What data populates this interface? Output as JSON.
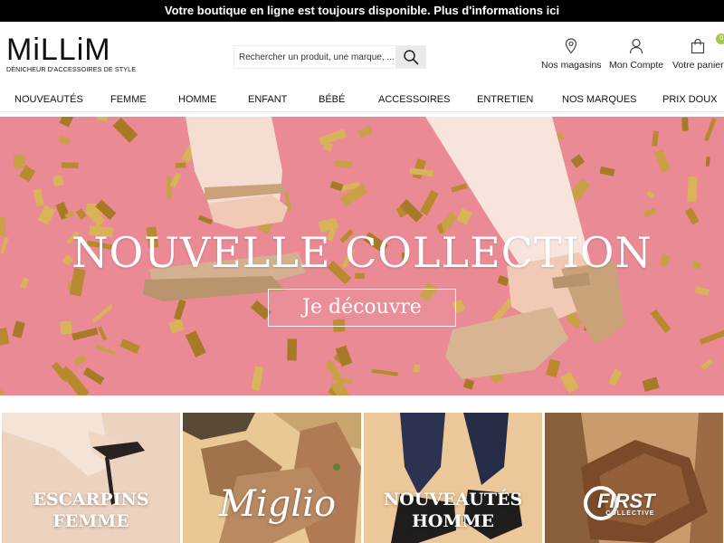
{
  "announcement": {
    "text": "Votre boutique en ligne est toujours disponible. Plus d'informations ici"
  },
  "brand": {
    "name": "MiLLiM",
    "tagline": "DÉNICHEUR D'ACCESSOIRES DE STYLE"
  },
  "search": {
    "placeholder": "Rechercher un produit, une marque, ..."
  },
  "header_actions": {
    "stores_label": "Nos magasins",
    "account_label": "Mon Compte",
    "cart_label": "Votre panier",
    "cart_count": "0"
  },
  "nav": {
    "items": [
      {
        "label": "NOUVEAUTÉS"
      },
      {
        "label": "FEMME"
      },
      {
        "label": "HOMME"
      },
      {
        "label": "ENFANT"
      },
      {
        "label": "BÉBÉ"
      },
      {
        "label": "ACCESSOIRES"
      },
      {
        "label": "ENTRETIEN"
      },
      {
        "label": "NOS MARQUES"
      },
      {
        "label": "PRIX DOUX"
      }
    ]
  },
  "hero": {
    "title": "NOUVELLE COLLECTION",
    "cta": "Je découvre"
  },
  "tiles": [
    {
      "label_line1": "ESCARPINS",
      "label_line2": "FEMME"
    },
    {
      "logo_text": "Miglio"
    },
    {
      "label_line1": "NOUVEAUTÉS",
      "label_line2": "HOMME"
    },
    {
      "logo_text": "FIRST",
      "logo_sub": "COLLECTIVE"
    }
  ],
  "colors": {
    "topbar_bg": "#000000",
    "hero_bg": "#e98a94",
    "cart_badge": "#a8c84a",
    "confetti_gold": "#c9a045"
  },
  "icons": [
    "search-icon",
    "map-pin-icon",
    "user-icon",
    "shopping-bag-icon"
  ]
}
